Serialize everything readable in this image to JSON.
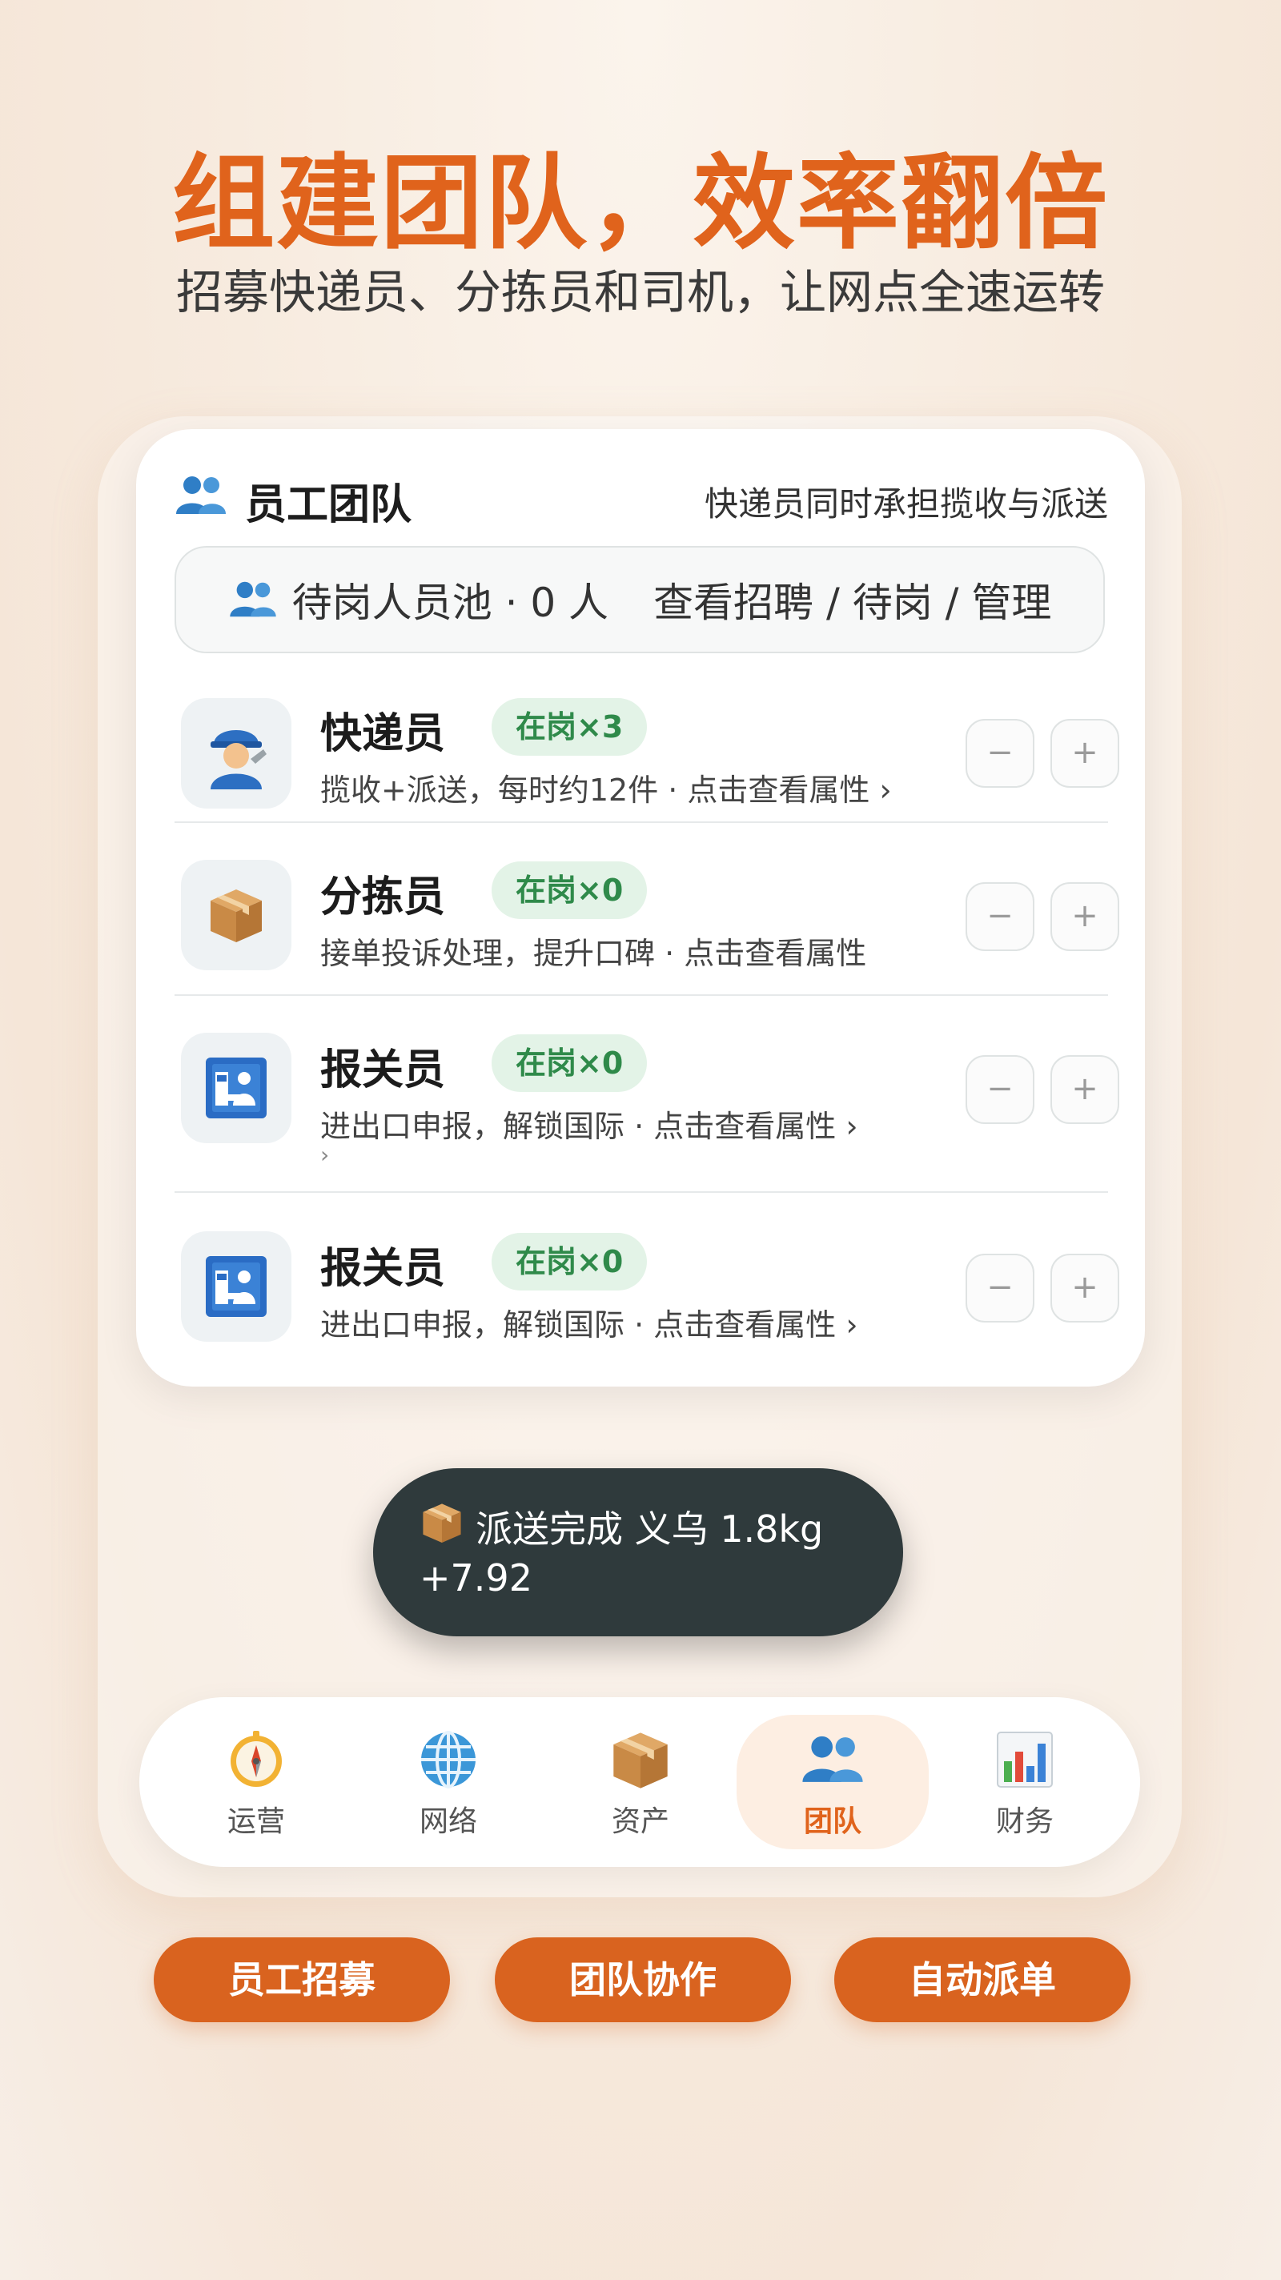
{
  "hero": {
    "title": "组建团队，效率翻倍",
    "subtitle": "招募快递员、分拣员和司机，让网点全速运转"
  },
  "card": {
    "icon": "people-icon",
    "title": "员工团队",
    "note": "快递员同时承担揽收与派送",
    "pool": {
      "text": "待岗人员池 · 0 人",
      "action": "查看招聘 / 待岗 / 管理"
    },
    "rows": [
      {
        "icon": "courier-avatar-icon",
        "name": "快递员",
        "badge": "在岗×3",
        "desc": "揽收+派送，每时约12件 · 点击查看属性 ›",
        "minus": "−",
        "plus": "+"
      },
      {
        "icon": "package-icon",
        "name": "分拣员",
        "badge": "在岗×0",
        "desc": "接单投诉处理，提升口碑 · 点击查看属性",
        "minus": "−",
        "plus": "+"
      },
      {
        "icon": "customs-officer-icon",
        "name": "报关员",
        "badge": "在岗×0",
        "desc": "进出口申报，解锁国际 · 点击查看属性 ›",
        "extra": "›",
        "minus": "−",
        "plus": "+"
      },
      {
        "icon": "customs-officer-icon",
        "name": "报关员",
        "badge": "在岗×0",
        "desc": "进出口申报，解锁国际 · 点击查看属性 ›",
        "minus": "−",
        "plus": "+"
      }
    ]
  },
  "toast": {
    "icon": "package-icon",
    "text": "派送完成 义乌 1.8kg",
    "amount": "+7.92"
  },
  "nav": {
    "active": "团队",
    "items": [
      {
        "label": "运营",
        "icon": "compass-icon"
      },
      {
        "label": "网络",
        "icon": "globe-icon"
      },
      {
        "label": "资产",
        "icon": "package-icon"
      },
      {
        "label": "团队",
        "icon": "people-icon"
      },
      {
        "label": "财务",
        "icon": "bar-chart-icon"
      }
    ]
  },
  "features": [
    "员工招募",
    "团队协作",
    "自动派单"
  ],
  "colors": {
    "accent": "#e0631c",
    "badge_bg": "#e3f3e7",
    "badge_text": "#2f8a4a",
    "toast_bg": "#2f3a3c",
    "people_icon": "#2f7ec6"
  }
}
